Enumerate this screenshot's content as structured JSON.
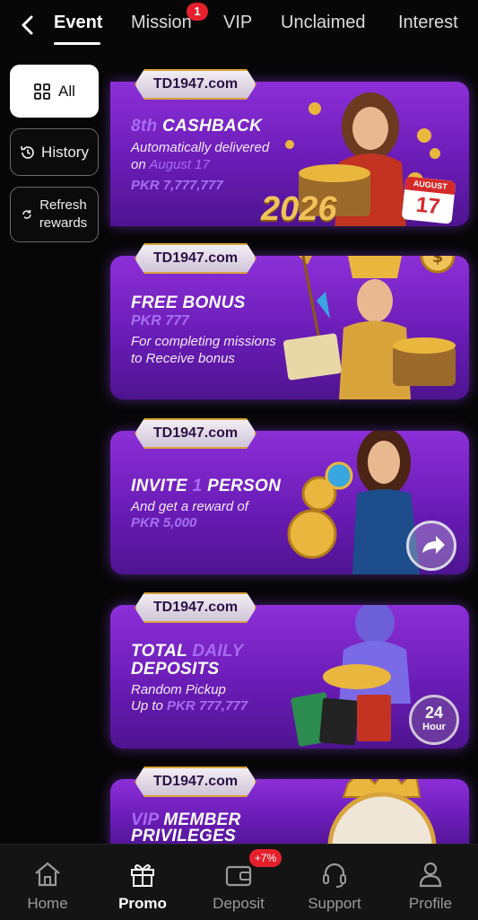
{
  "tabs": [
    {
      "label": "Event"
    },
    {
      "label": "Mission",
      "badge": "1"
    },
    {
      "label": "VIP"
    },
    {
      "label": "Unclaimed"
    },
    {
      "label": "Interest"
    }
  ],
  "sidebar": {
    "all": "All",
    "history": "History",
    "refresh_line1": "Refresh",
    "refresh_line2": "rewards"
  },
  "banners": [
    {
      "chip": "TD1947.com",
      "title_prefix": "8th",
      "title": "CASHBACK",
      "line1": "Automatically delivered",
      "line2_prefix": "on",
      "line2_hl": "August 17",
      "amount": "PKR 7,777,777",
      "year": "2026",
      "calendar_month": "AUGUST",
      "calendar_day": "17"
    },
    {
      "chip": "TD1947.com",
      "title": "FREE BONUS",
      "subtitle": "PKR 777",
      "line1": "For completing missions",
      "line2": "to Receive bonus"
    },
    {
      "chip": "TD1947.com",
      "title_a": "INVITE",
      "title_num": "1",
      "title_b": "PERSON",
      "line1": "And get a reward of",
      "amount": "PKR 5,000"
    },
    {
      "chip": "TD1947.com",
      "title_a": "TOTAL",
      "title_hl": "DAILY",
      "title_b": "DEPOSITS",
      "line1": "Random Pickup",
      "line2_prefix": "Up to",
      "line2_hl": "PKR 777,777",
      "badge_num": "24",
      "badge_text": "Hour"
    },
    {
      "chip": "TD1947.com",
      "title_hl": "VIP",
      "title_a": "MEMBER",
      "title_b": "PRIVILEGES"
    }
  ],
  "bottom_nav": [
    {
      "label": "Home",
      "icon": "home-icon"
    },
    {
      "label": "Promo",
      "icon": "gift-icon"
    },
    {
      "label": "Deposit",
      "icon": "wallet-icon",
      "badge": "+7%"
    },
    {
      "label": "Support",
      "icon": "headset-icon"
    },
    {
      "label": "Profile",
      "icon": "person-icon"
    }
  ],
  "colors": {
    "accent": "#a86bf2",
    "badge": "#e5202c",
    "banner_top": "#8c2fd8",
    "banner_bottom": "#4e1490"
  }
}
